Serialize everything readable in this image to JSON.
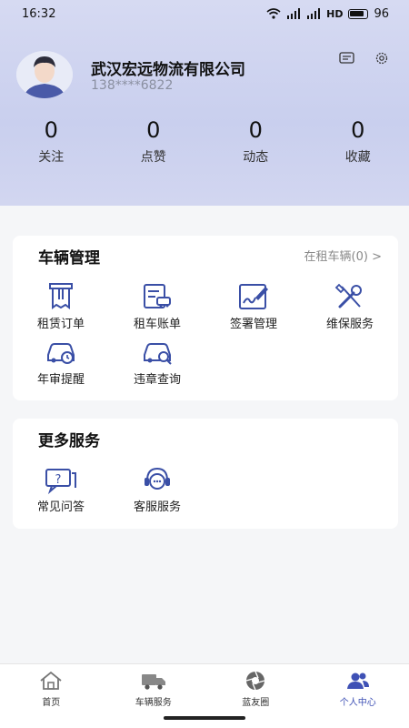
{
  "status_bar": {
    "time": "16:32",
    "network": "HD",
    "battery": "96"
  },
  "profile": {
    "company": "武汉宏远物流有限公司",
    "phone": "138****6822"
  },
  "stats": [
    {
      "count": "0",
      "label": "关注"
    },
    {
      "count": "0",
      "label": "点赞"
    },
    {
      "count": "0",
      "label": "动态"
    },
    {
      "count": "0",
      "label": "收藏"
    }
  ],
  "vehicle_section": {
    "title": "车辆管理",
    "link": "在租车辆(0) >",
    "items": [
      {
        "label": "租赁订单",
        "icon": "rental-order-icon"
      },
      {
        "label": "租车账单",
        "icon": "rental-bill-icon"
      },
      {
        "label": "签署管理",
        "icon": "signature-icon"
      },
      {
        "label": "维保服务",
        "icon": "maintenance-icon"
      },
      {
        "label": "年审提醒",
        "icon": "annual-inspection-icon"
      },
      {
        "label": "违章查询",
        "icon": "violation-query-icon"
      }
    ]
  },
  "more_section": {
    "title": "更多服务",
    "items": [
      {
        "label": "常见问答",
        "icon": "faq-icon"
      },
      {
        "label": "客服服务",
        "icon": "customer-service-icon"
      }
    ]
  },
  "bottom_nav": [
    {
      "label": "首页",
      "icon": "home-icon"
    },
    {
      "label": "车辆服务",
      "icon": "truck-icon"
    },
    {
      "label": "蓝友圈",
      "icon": "aperture-icon"
    },
    {
      "label": "个人中心",
      "icon": "people-icon",
      "active": true
    }
  ],
  "colors": {
    "accent": "#3f51b5",
    "icon_blue": "#3a4fa6",
    "header_bg": "#d0d5ef"
  }
}
